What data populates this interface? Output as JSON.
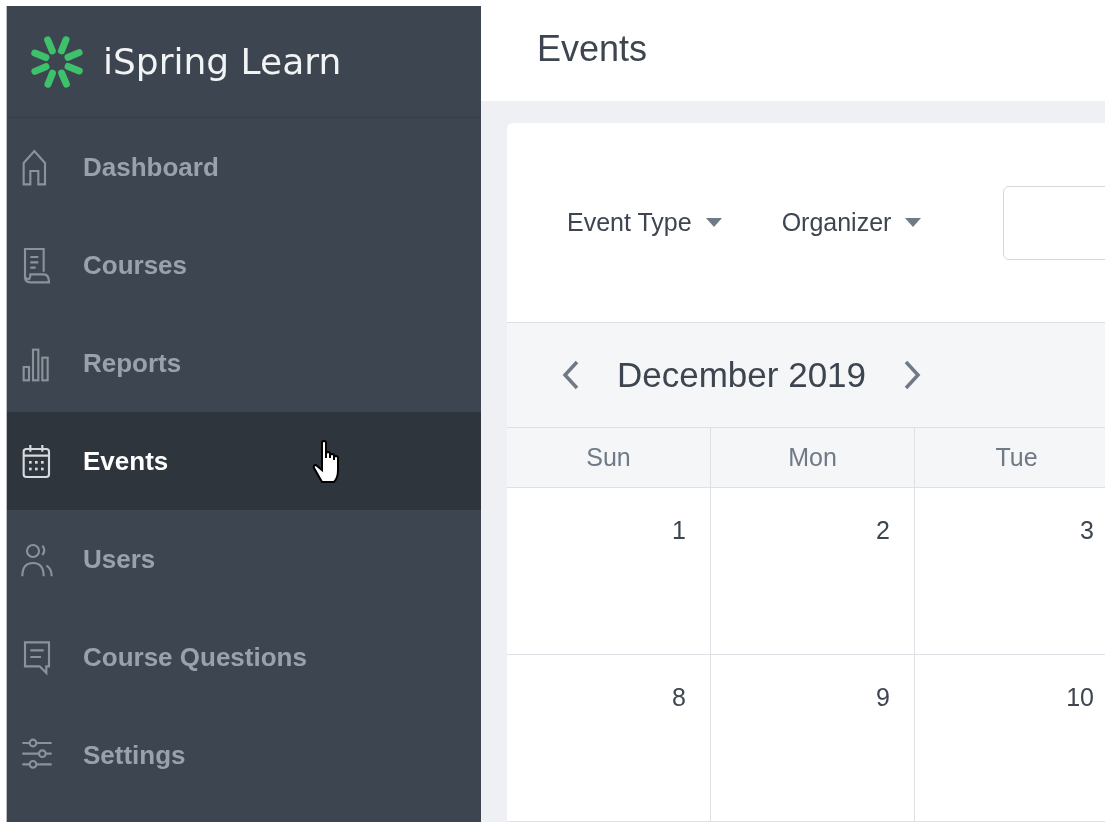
{
  "app": {
    "name": "iSpring Learn"
  },
  "sidebar": {
    "items": [
      {
        "label": "Dashboard",
        "kind": "home",
        "selected": false
      },
      {
        "label": "Courses",
        "kind": "courses",
        "selected": false
      },
      {
        "label": "Reports",
        "kind": "reports",
        "selected": false
      },
      {
        "label": "Events",
        "kind": "events",
        "selected": true
      },
      {
        "label": "Users",
        "kind": "users",
        "selected": false
      },
      {
        "label": "Course Questions",
        "kind": "questions",
        "selected": false
      },
      {
        "label": "Settings",
        "kind": "settings",
        "selected": false
      }
    ]
  },
  "page": {
    "title": "Events"
  },
  "filters": [
    {
      "label": "Event Type"
    },
    {
      "label": "Organizer"
    }
  ],
  "calendar": {
    "month": "December 2019",
    "weekdays": [
      "Sun",
      "Mon",
      "Tue"
    ],
    "weeks": [
      [
        "1",
        "2",
        "3"
      ],
      [
        "8",
        "9",
        "10"
      ]
    ]
  }
}
